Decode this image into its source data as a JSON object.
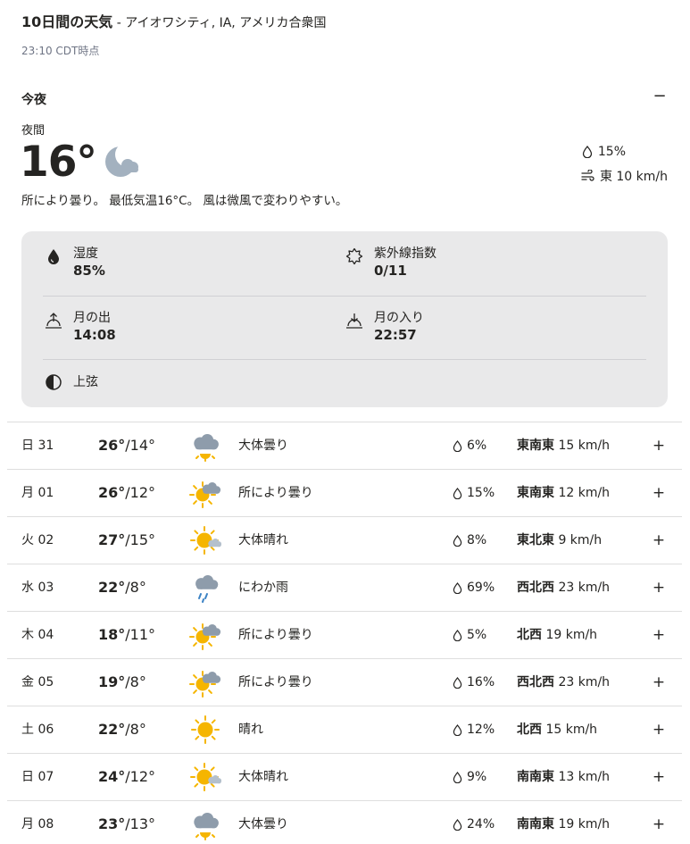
{
  "header": {
    "title": "10日間の天気",
    "separator": " - ",
    "location": "アイオワシティ, IA, アメリカ合衆国",
    "as_of": "23:10 CDT時点"
  },
  "tonight": {
    "heading": "今夜",
    "collapse_label": "−",
    "daypart": "夜間",
    "temp": "16°",
    "icon": "partly-cloudy-night-icon",
    "precip": "15%",
    "wind": "東 10 km/h",
    "narrative": "所により曇り。 最低気温16°C。 風は微風で変わりやすい。",
    "details": {
      "humidity_label": "湿度",
      "humidity_value": "85%",
      "uv_label": "紫外線指数",
      "uv_value": "0/11",
      "moonrise_label": "月の出",
      "moonrise_value": "14:08",
      "moonset_label": "月の入り",
      "moonset_value": "22:57",
      "moon_phase": "上弦"
    }
  },
  "days": [
    {
      "day": "日 31",
      "hi": "26°",
      "sep": "/",
      "lo": "14°",
      "icon": "mostly-cloudy",
      "cond": "大体曇り",
      "precip": "6%",
      "wind_dir": "東南東",
      "wind_speed": " 15 km/h",
      "expand": "+"
    },
    {
      "day": "月 01",
      "hi": "26°",
      "sep": "/",
      "lo": "12°",
      "icon": "partly-cloudy",
      "cond": "所により曇り",
      "precip": "15%",
      "wind_dir": "東南東",
      "wind_speed": " 12 km/h",
      "expand": "+"
    },
    {
      "day": "火 02",
      "hi": "27°",
      "sep": "/",
      "lo": "15°",
      "icon": "mostly-sunny",
      "cond": "大体晴れ",
      "precip": "8%",
      "wind_dir": "東北東",
      "wind_speed": " 9 km/h",
      "expand": "+"
    },
    {
      "day": "水 03",
      "hi": "22°",
      "sep": "/",
      "lo": "8°",
      "icon": "showers",
      "cond": "にわか雨",
      "precip": "69%",
      "wind_dir": "西北西",
      "wind_speed": " 23 km/h",
      "expand": "+"
    },
    {
      "day": "木 04",
      "hi": "18°",
      "sep": "/",
      "lo": "11°",
      "icon": "partly-cloudy",
      "cond": "所により曇り",
      "precip": "5%",
      "wind_dir": "北西",
      "wind_speed": " 19 km/h",
      "expand": "+"
    },
    {
      "day": "金 05",
      "hi": "19°",
      "sep": "/",
      "lo": "8°",
      "icon": "partly-cloudy",
      "cond": "所により曇り",
      "precip": "16%",
      "wind_dir": "西北西",
      "wind_speed": " 23 km/h",
      "expand": "+"
    },
    {
      "day": "土 06",
      "hi": "22°",
      "sep": "/",
      "lo": "8°",
      "icon": "sunny",
      "cond": "晴れ",
      "precip": "12%",
      "wind_dir": "北西",
      "wind_speed": " 15 km/h",
      "expand": "+"
    },
    {
      "day": "日 07",
      "hi": "24°",
      "sep": "/",
      "lo": "12°",
      "icon": "mostly-sunny",
      "cond": "大体晴れ",
      "precip": "9%",
      "wind_dir": "南南東",
      "wind_speed": " 13 km/h",
      "expand": "+"
    },
    {
      "day": "月 08",
      "hi": "23°",
      "sep": "/",
      "lo": "13°",
      "icon": "mostly-cloudy",
      "cond": "大体曇り",
      "precip": "24%",
      "wind_dir": "南南東",
      "wind_speed": " 19 km/h",
      "expand": "+"
    }
  ],
  "colors": {
    "sun": "#f5b500",
    "cloud": "#8e9cab",
    "cloud_light": "#b4c0cc",
    "rain": "#3b82c4",
    "panel": "#e9e9ea",
    "text": "#252422"
  }
}
